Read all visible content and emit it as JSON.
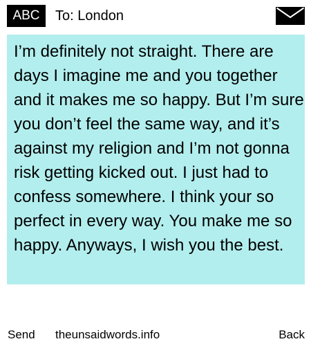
{
  "header": {
    "badge_label": "ABC",
    "recipient": "To: London",
    "envelope_icon": "envelope-icon"
  },
  "message": {
    "text": "I’m definitely not straight. There are days I imagine me and you together and it makes me so happy. But I’m sure you don’t feel the same way, and it’s against my religion and I’m not gonna risk getting kicked out. I just had to confess somewhere. I think your so perfect in every way. You make me so happy. Anyways, I wish you the best.",
    "highlight_color": "#b3eeee"
  },
  "footer": {
    "send_label": "Send",
    "site_label": "theunsaidwords.info",
    "back_label": "Back"
  }
}
